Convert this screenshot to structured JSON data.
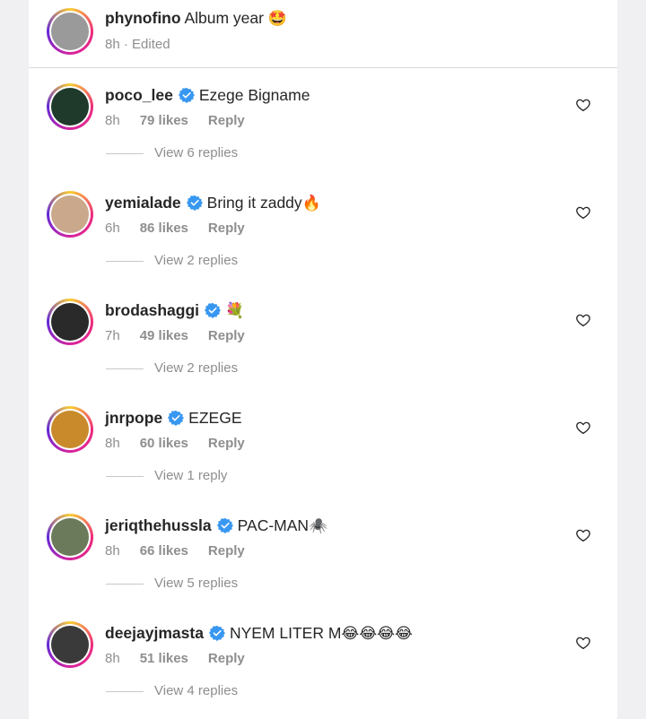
{
  "caption": {
    "username": "phynofino",
    "text": "Album year",
    "emoji": "🤩",
    "meta": "8h · Edited",
    "avatar_color": "#9a9a9a"
  },
  "comments": [
    {
      "username": "poco_lee",
      "verified": true,
      "text": "Ezege Bigname",
      "emoji": "",
      "time": "8h",
      "likes": "79 likes",
      "reply": "Reply",
      "replies": "View 6 replies",
      "avatar_color": "#1f3a2a"
    },
    {
      "username": "yemialade",
      "verified": true,
      "text": "Bring it zaddy",
      "emoji": "🔥",
      "time": "6h",
      "likes": "86 likes",
      "reply": "Reply",
      "replies": "View 2 replies",
      "avatar_color": "#c9a88c"
    },
    {
      "username": "brodashaggi",
      "verified": true,
      "text": "",
      "emoji": "💐",
      "time": "7h",
      "likes": "49 likes",
      "reply": "Reply",
      "replies": "View 2 replies",
      "avatar_color": "#2a2a2a"
    },
    {
      "username": "jnrpope",
      "verified": true,
      "text": "EZEGE",
      "emoji": "",
      "time": "8h",
      "likes": "60 likes",
      "reply": "Reply",
      "replies": "View 1 reply",
      "avatar_color": "#c98a2b"
    },
    {
      "username": "jeriqthehussla",
      "verified": true,
      "text": "PAC-MAN",
      "emoji": "🕷️",
      "time": "8h",
      "likes": "66 likes",
      "reply": "Reply",
      "replies": "View 5 replies",
      "avatar_color": "#6a7a5a"
    },
    {
      "username": "deejayjmasta",
      "verified": true,
      "text": "NYEM LITER M",
      "emoji": "😂😂😂😂",
      "time": "8h",
      "likes": "51 likes",
      "reply": "Reply",
      "replies": "View 4 replies",
      "avatar_color": "#3a3a3a"
    }
  ],
  "colors": {
    "verified": "#3897f0",
    "muted": "#8e8e8e",
    "text": "#262626"
  }
}
